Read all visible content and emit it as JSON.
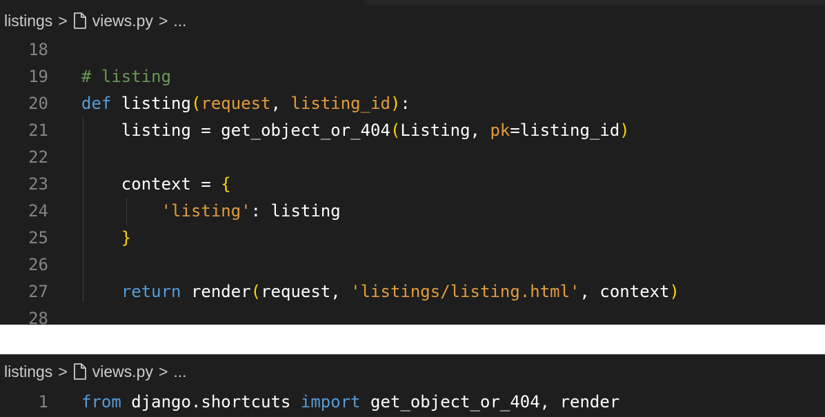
{
  "top_panel": {
    "breadcrumb": {
      "folder": "listings",
      "file": "views.py",
      "more": "...",
      "separator": ">"
    },
    "lines": [
      {
        "num": "18",
        "tokens": []
      },
      {
        "num": "19",
        "tokens": [
          {
            "cls": "com",
            "text": "# listing"
          }
        ]
      },
      {
        "num": "20",
        "tokens": [
          {
            "cls": "kw",
            "text": "def "
          },
          {
            "cls": "plain",
            "text": "listing"
          },
          {
            "cls": "br",
            "text": "("
          },
          {
            "cls": "prm",
            "text": "request"
          },
          {
            "cls": "plain",
            "text": ", "
          },
          {
            "cls": "prm",
            "text": "listing_id"
          },
          {
            "cls": "br",
            "text": ")"
          },
          {
            "cls": "plain",
            "text": ":"
          }
        ]
      },
      {
        "num": "21",
        "tokens": [
          {
            "cls": "plain",
            "text": "    listing = get_object_or_404"
          },
          {
            "cls": "br",
            "text": "("
          },
          {
            "cls": "plain",
            "text": "Listing, "
          },
          {
            "cls": "prm",
            "text": "pk"
          },
          {
            "cls": "plain",
            "text": "=listing_id"
          },
          {
            "cls": "br",
            "text": ")"
          }
        ]
      },
      {
        "num": "22",
        "tokens": []
      },
      {
        "num": "23",
        "tokens": [
          {
            "cls": "plain",
            "text": "    context = "
          },
          {
            "cls": "br",
            "text": "{"
          }
        ]
      },
      {
        "num": "24",
        "tokens": [
          {
            "cls": "plain",
            "text": "        "
          },
          {
            "cls": "prm",
            "text": "'listing'"
          },
          {
            "cls": "plain",
            "text": ": listing"
          }
        ]
      },
      {
        "num": "25",
        "tokens": [
          {
            "cls": "plain",
            "text": "    "
          },
          {
            "cls": "br",
            "text": "}"
          }
        ]
      },
      {
        "num": "26",
        "tokens": []
      },
      {
        "num": "27",
        "tokens": [
          {
            "cls": "plain",
            "text": "    "
          },
          {
            "cls": "kw",
            "text": "return "
          },
          {
            "cls": "plain",
            "text": "render"
          },
          {
            "cls": "br",
            "text": "("
          },
          {
            "cls": "plain",
            "text": "request, "
          },
          {
            "cls": "prm",
            "text": "'listings/listing.html'"
          },
          {
            "cls": "plain",
            "text": ", context"
          },
          {
            "cls": "br",
            "text": ")"
          }
        ]
      },
      {
        "num": "28",
        "tokens": []
      }
    ]
  },
  "bottom_panel": {
    "breadcrumb": {
      "folder": "listings",
      "file": "views.py",
      "more": "...",
      "separator": ">"
    },
    "lines": [
      {
        "num": "1",
        "tokens": [
          {
            "cls": "kw",
            "text": "from "
          },
          {
            "cls": "plain",
            "text": "django.shortcuts "
          },
          {
            "cls": "kw",
            "text": "import "
          },
          {
            "cls": "plain",
            "text": "get_object_or_404, render"
          }
        ]
      }
    ]
  },
  "colors": {
    "editor_bg": "#1e1e1e",
    "keyword": "#569cd6",
    "parameter": "#e39c3c",
    "bracket": "#ffd700",
    "comment": "#6a9955",
    "line_number": "#858585"
  }
}
